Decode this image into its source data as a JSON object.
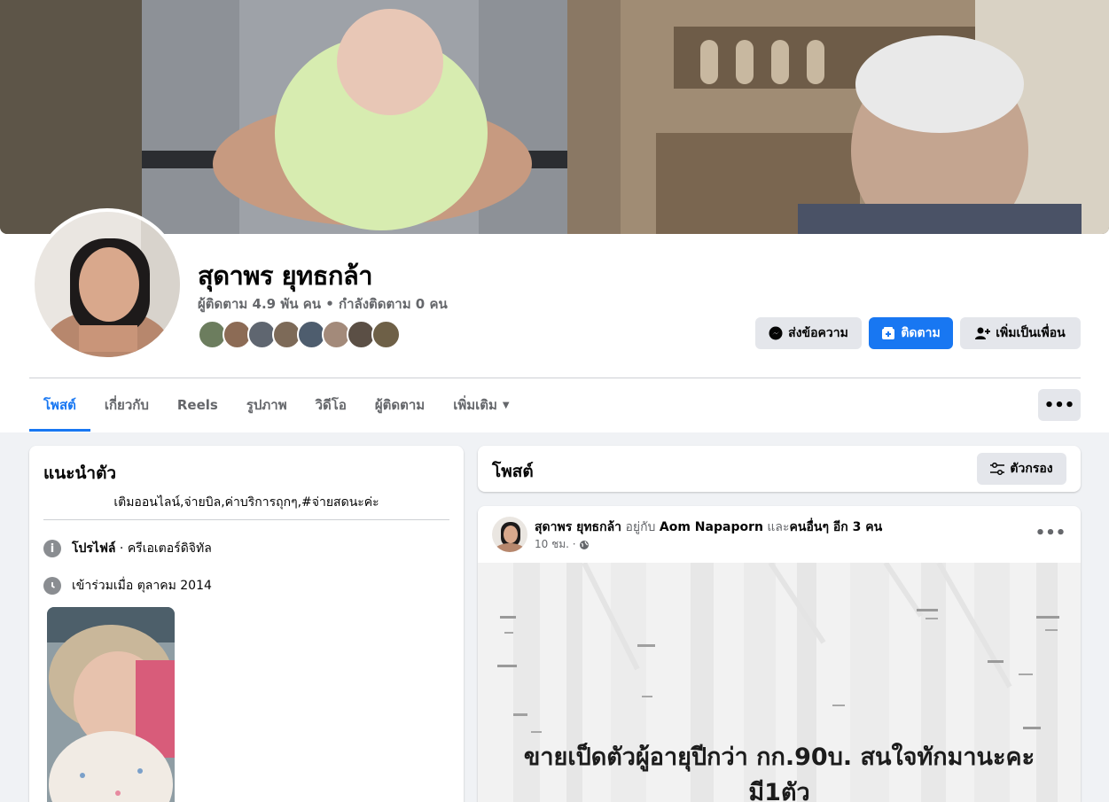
{
  "profile": {
    "name": "สุดาพร ยุทธกล้า",
    "follow_stats": "ผู้ติดตาม 4.9 พัน คน • กำลังติดตาม 0 คน"
  },
  "actions": {
    "message_label": "ส่งข้อความ",
    "follow_label": "ติดตาม",
    "add_friend_label": "เพิ่มเป็นเพื่อน"
  },
  "tabs": [
    {
      "label": "โพสต์"
    },
    {
      "label": "เกี่ยวกับ"
    },
    {
      "label": "Reels"
    },
    {
      "label": "รูปภาพ"
    },
    {
      "label": "วิดีโอ"
    },
    {
      "label": "ผู้ติดตาม"
    },
    {
      "label": "เพิ่มเติม"
    }
  ],
  "more_label": "•••",
  "intro": {
    "title": "แนะนำตัว",
    "bio": "เติมออนไลน์,จ่ายบิล,ค่าบริการถุกๆ,#จ่ายสดนะค่ะ",
    "profile_label": "โปรไฟล์",
    "profile_value": " · ครีเอเตอร์ดิจิทัล",
    "joined": "เข้าร่วมเมื่อ ตุลาคม 2014"
  },
  "posts_section": {
    "title": "โพสต์",
    "filter_label": "ตัวกรอง"
  },
  "post": {
    "author": "สุดาพร ยุทธกล้า",
    "with_text": " อยู่กับ ",
    "tagged": "Aom Napaporn",
    "and_text": " และ",
    "others": "คนอื่นๆ อีก 3 คน",
    "time": "10 ชม. ·",
    "dots": "•••",
    "text": "ขายเป็ดตัวผู้อายุปีกว่า กก.90บ. สนใจทักมานะคะมี1ตัว"
  },
  "colors": {
    "accent": "#1877f2",
    "secondary_button": "#e4e6eb",
    "muted_text": "#65676b",
    "page_bg": "#f0f2f5"
  }
}
